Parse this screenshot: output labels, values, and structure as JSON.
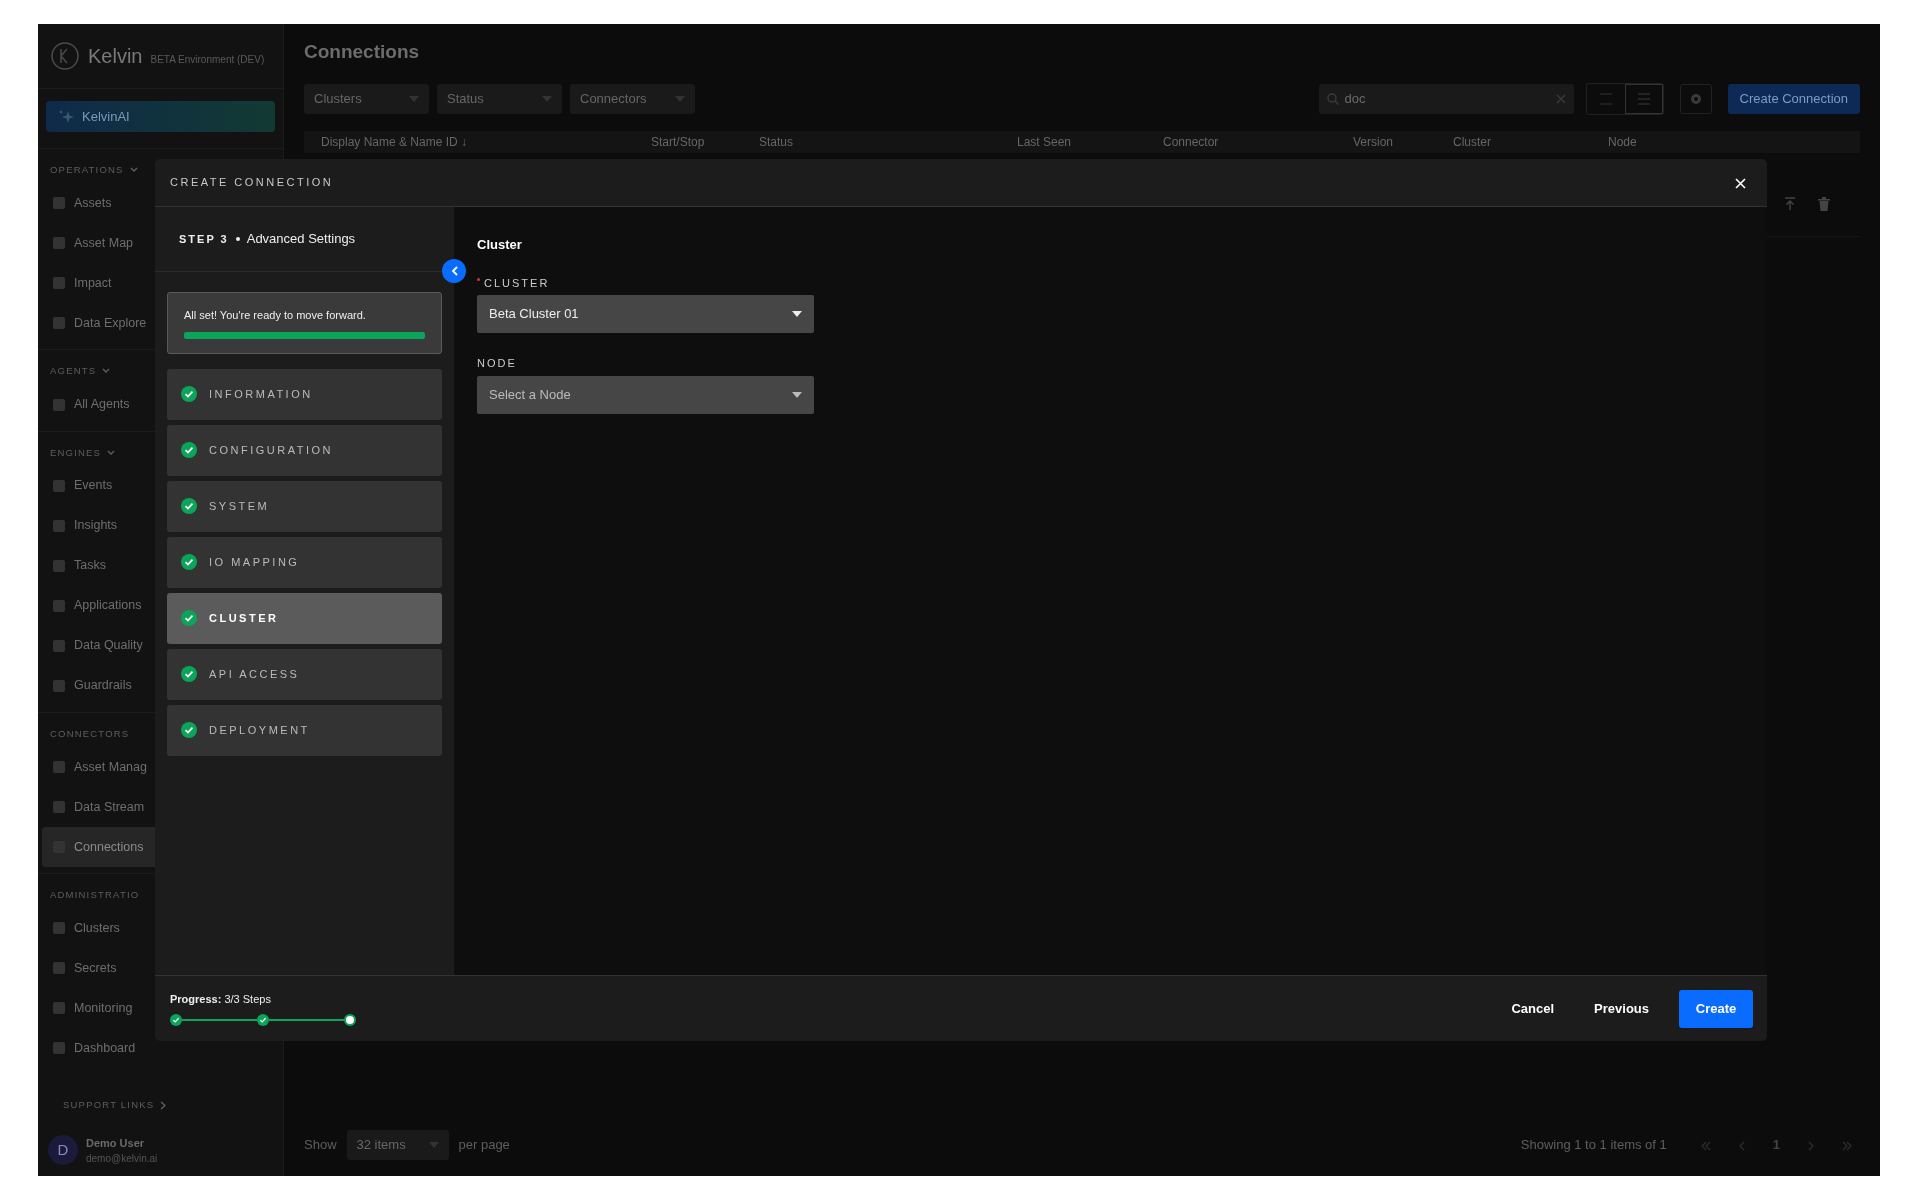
{
  "sidebar": {
    "brand": "Kelvin",
    "environment": "BETA Environment (DEV)",
    "ai_button": "KelvinAI",
    "sections": [
      {
        "title": "OPERATIONS",
        "expandable": true,
        "items": [
          {
            "label": "Assets",
            "selected": false
          },
          {
            "label": "Asset Map",
            "selected": false
          },
          {
            "label": "Impact",
            "selected": false
          },
          {
            "label": "Data Explore",
            "selected": false
          }
        ]
      },
      {
        "title": "AGENTS",
        "expandable": true,
        "items": [
          {
            "label": "All Agents",
            "selected": false
          }
        ]
      },
      {
        "title": "ENGINES",
        "expandable": true,
        "items": [
          {
            "label": "Events",
            "selected": false
          },
          {
            "label": "Insights",
            "selected": false
          },
          {
            "label": "Tasks",
            "selected": false
          },
          {
            "label": "Applications",
            "selected": false
          },
          {
            "label": "Data Quality",
            "selected": false
          },
          {
            "label": "Guardrails",
            "selected": false
          }
        ]
      },
      {
        "title": "CONNECTORS",
        "expandable": false,
        "items": [
          {
            "label": "Asset Manag",
            "selected": false
          },
          {
            "label": "Data Stream",
            "selected": false
          },
          {
            "label": "Connections",
            "selected": true
          }
        ]
      },
      {
        "title": "ADMINISTRATIO",
        "expandable": false,
        "items": [
          {
            "label": "Clusters",
            "selected": false
          },
          {
            "label": "Secrets",
            "selected": false
          },
          {
            "label": "Monitoring",
            "selected": false
          },
          {
            "label": "Dashboard",
            "selected": false
          }
        ]
      }
    ],
    "support_links": "SUPPORT LINKS",
    "user": {
      "initial": "D",
      "name": "Demo User",
      "email": "demo@kelvin.ai"
    }
  },
  "page": {
    "title": "Connections",
    "filters": [
      "Clusters",
      "Status",
      "Connectors"
    ],
    "search": {
      "value": "doc"
    },
    "create_button": "Create Connection",
    "table": {
      "columns": [
        "Display Name & Name ID ↓",
        "Start/Stop",
        "Status",
        "Last Seen",
        "Connector",
        "Version",
        "Cluster",
        "Node"
      ]
    }
  },
  "pagination": {
    "show": "Show",
    "page_size": "32 items",
    "per_page": "per page",
    "summary": "Showing 1 to 1 items of 1",
    "current_page": "1"
  },
  "modal": {
    "title": "CREATE CONNECTION",
    "step_label": "STEP 3",
    "step_name": "Advanced Settings",
    "ready": {
      "text": "All set! You're ready to move forward.",
      "level": 1
    },
    "steps": [
      {
        "label": "INFORMATION",
        "done": true,
        "selected": false
      },
      {
        "label": "CONFIGURATION",
        "done": true,
        "selected": false
      },
      {
        "label": "SYSTEM",
        "done": true,
        "selected": false
      },
      {
        "label": "IO MAPPING",
        "done": true,
        "selected": false
      },
      {
        "label": "CLUSTER",
        "done": true,
        "selected": true
      },
      {
        "label": "API ACCESS",
        "done": true,
        "selected": false
      },
      {
        "label": "DEPLOYMENT",
        "done": true,
        "selected": false
      }
    ],
    "section_title": "Cluster",
    "fields": [
      {
        "label": "CLUSTER",
        "required": true,
        "value": "Beta Cluster 01"
      },
      {
        "label": "NODE",
        "required": false,
        "placeholder": "Select a Node"
      }
    ],
    "progress": {
      "text": "**Progress:** 3/3 Steps",
      "stages": [
        {
          "done": true
        },
        {
          "done": true
        },
        {
          "done": false
        }
      ]
    },
    "buttons": [
      {
        "label": "Cancel",
        "kind": "text"
      },
      {
        "label": "Previous",
        "kind": "text"
      },
      {
        "label": "Create",
        "kind": "primary"
      }
    ]
  }
}
